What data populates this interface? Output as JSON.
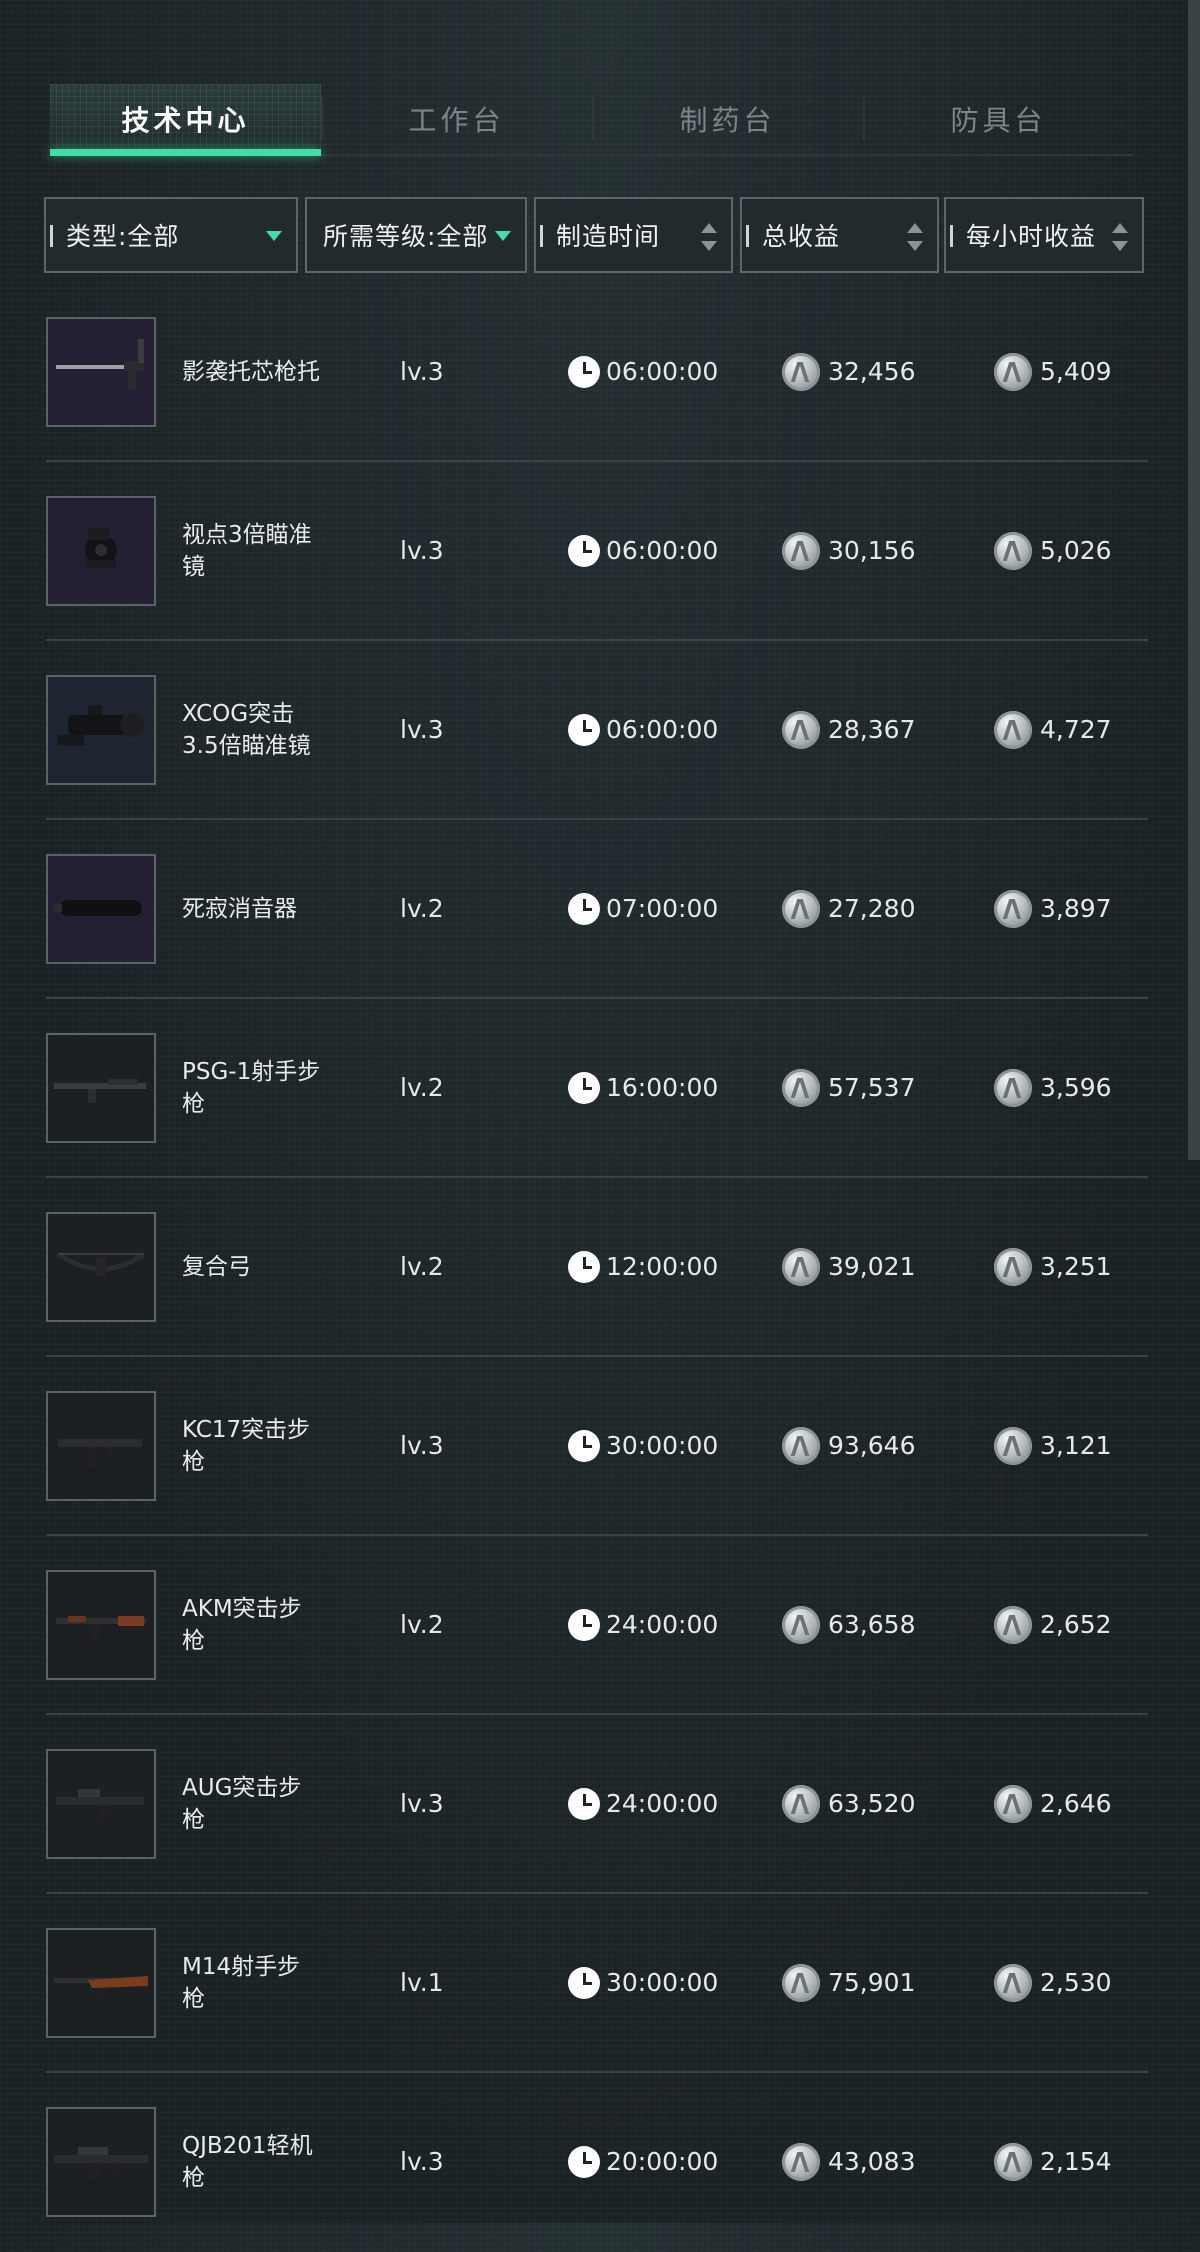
{
  "tabs": [
    {
      "label": "技术中心",
      "active": true
    },
    {
      "label": "工作台",
      "active": false
    },
    {
      "label": "制药台",
      "active": false
    },
    {
      "label": "防具台",
      "active": false
    }
  ],
  "filters": {
    "type": "类型:全部",
    "level": "所需等级:全部",
    "time": "制造时间",
    "total": "总收益",
    "per_hour": "每小时收益"
  },
  "colors": {
    "accent": "#3fe0a8"
  },
  "items": [
    {
      "name": "影袭托芯枪托",
      "level": "lv.3",
      "time": "06:00:00",
      "total": "32,456",
      "per_hour": "5,409",
      "icon": "stock-icon"
    },
    {
      "name": "视点3倍瞄准镜",
      "level": "lv.3",
      "time": "06:00:00",
      "total": "30,156",
      "per_hour": "5,026",
      "icon": "scope-icon"
    },
    {
      "name": "XCOG突击3.5倍瞄准镜",
      "level": "lv.3",
      "time": "06:00:00",
      "total": "28,367",
      "per_hour": "4,727",
      "icon": "acog-scope-icon"
    },
    {
      "name": "死寂消音器",
      "level": "lv.2",
      "time": "07:00:00",
      "total": "27,280",
      "per_hour": "3,897",
      "icon": "suppressor-icon"
    },
    {
      "name": "PSG-1射手步枪",
      "level": "lv.2",
      "time": "16:00:00",
      "total": "57,537",
      "per_hour": "3,596",
      "icon": "rifle-icon"
    },
    {
      "name": "复合弓",
      "level": "lv.2",
      "time": "12:00:00",
      "total": "39,021",
      "per_hour": "3,251",
      "icon": "bow-icon"
    },
    {
      "name": "KC17突击步枪",
      "level": "lv.3",
      "time": "30:00:00",
      "total": "93,646",
      "per_hour": "3,121",
      "icon": "rifle-icon"
    },
    {
      "name": "AKM突击步枪",
      "level": "lv.2",
      "time": "24:00:00",
      "total": "63,658",
      "per_hour": "2,652",
      "icon": "ak-rifle-icon"
    },
    {
      "name": "AUG突击步枪",
      "level": "lv.3",
      "time": "24:00:00",
      "total": "63,520",
      "per_hour": "2,646",
      "icon": "rifle-icon"
    },
    {
      "name": "M14射手步枪",
      "level": "lv.1",
      "time": "30:00:00",
      "total": "75,901",
      "per_hour": "2,530",
      "icon": "wood-rifle-icon"
    },
    {
      "name": "QJB201轻机枪",
      "level": "lv.3",
      "time": "20:00:00",
      "total": "43,083",
      "per_hour": "2,154",
      "icon": "lmg-icon"
    }
  ]
}
